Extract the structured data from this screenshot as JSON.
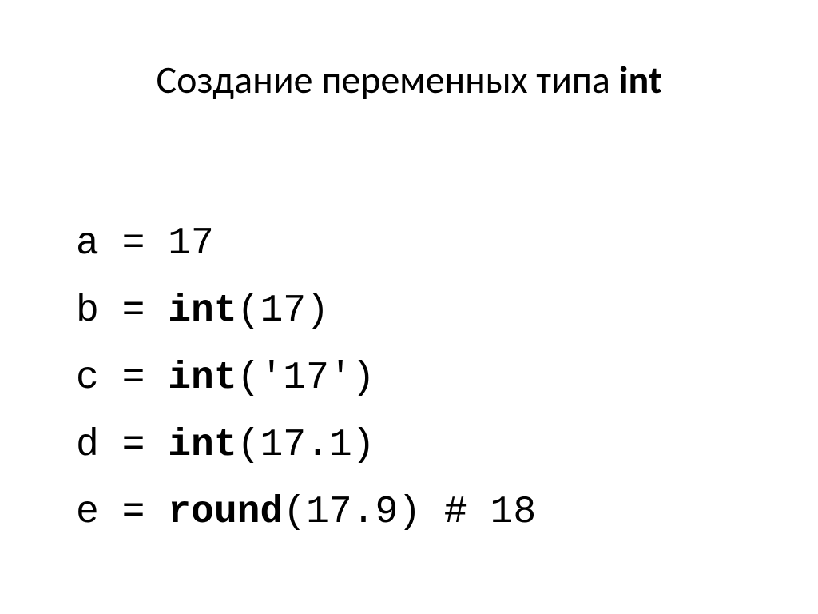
{
  "title": {
    "prefix": "Создание переменных типа ",
    "keyword": "int"
  },
  "code": {
    "lines": [
      {
        "var": "a",
        "pre": " = ",
        "kw": "",
        "rest": "17"
      },
      {
        "var": "b",
        "pre": " = ",
        "kw": "int",
        "rest": "(17)"
      },
      {
        "var": "c",
        "pre": " = ",
        "kw": "int",
        "rest": "('17')"
      },
      {
        "var": "d",
        "pre": " = ",
        "kw": "int",
        "rest": "(17.1)"
      },
      {
        "var": "e",
        "pre": " = ",
        "kw": "round",
        "rest": "(17.9) # 18"
      }
    ]
  }
}
